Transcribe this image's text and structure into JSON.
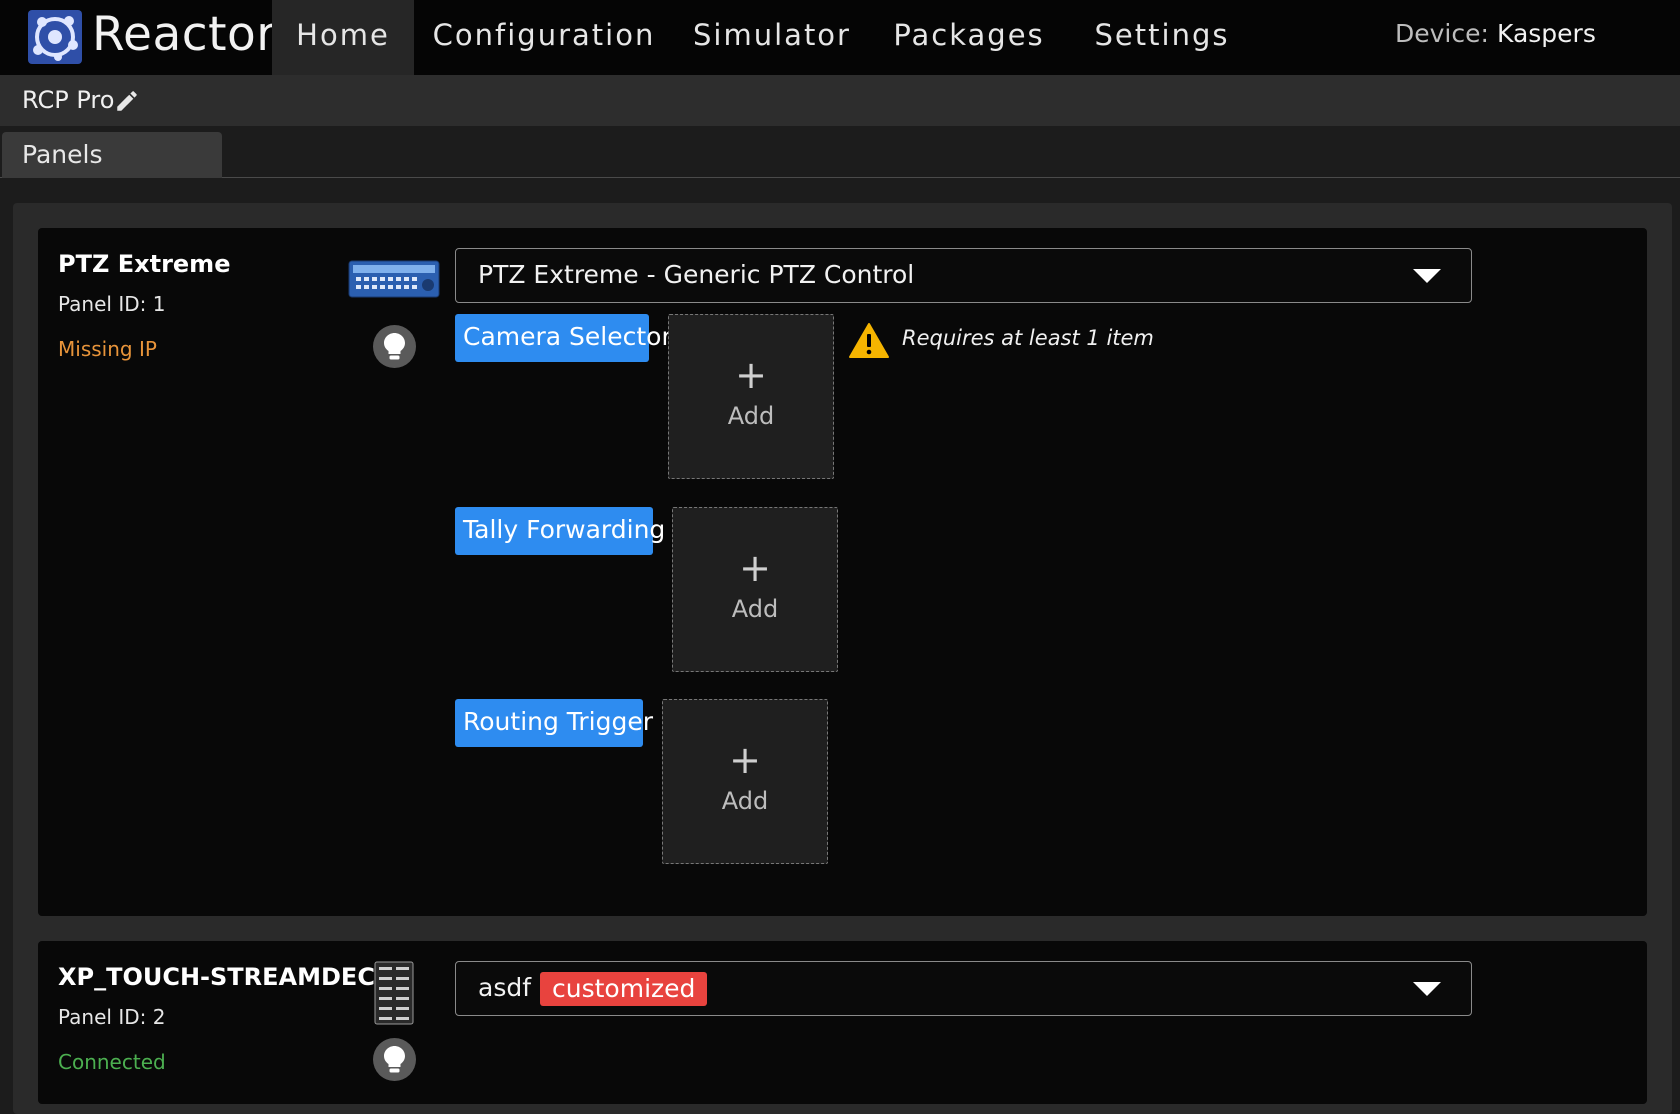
{
  "app": {
    "brand": "Reactor",
    "nav": [
      {
        "label": "Home",
        "active": true
      },
      {
        "label": "Configuration",
        "active": false
      },
      {
        "label": "Simulator",
        "active": false
      },
      {
        "label": "Packages",
        "active": false
      },
      {
        "label": "Settings",
        "active": false
      }
    ],
    "device_label": "Device:",
    "device_value": "Kaspers"
  },
  "project": {
    "name": "RCP Pro",
    "edit_icon": "pencil-icon"
  },
  "tabs": [
    {
      "label": "Panels",
      "active": true
    }
  ],
  "panels": [
    {
      "name": "PTZ Extreme",
      "panel_id": "Panel ID: 1",
      "status": "Missing IP",
      "status_color": "#e8943a",
      "configuration": "PTZ Extreme - Generic PTZ Control",
      "features": [
        {
          "label": "Camera Selector",
          "add_label": "Add",
          "add_icon": "+"
        },
        {
          "label": "Tally Forwarding",
          "add_label": "Add",
          "add_icon": "+"
        },
        {
          "label": "Routing Trigger",
          "add_label": "Add",
          "add_icon": "+"
        }
      ],
      "warning": "Requires at least 1 item"
    },
    {
      "name": "XP_TOUCH-STREAMDECK",
      "panel_id": "Panel ID: 2",
      "status": "Connected",
      "status_color": "#4caf50",
      "configuration": "asdf",
      "badge": "customized"
    }
  ],
  "colors": {
    "accent_blue": "#2e8cf0",
    "badge_red": "#e8433e",
    "warning_yellow": "#f5b400"
  }
}
